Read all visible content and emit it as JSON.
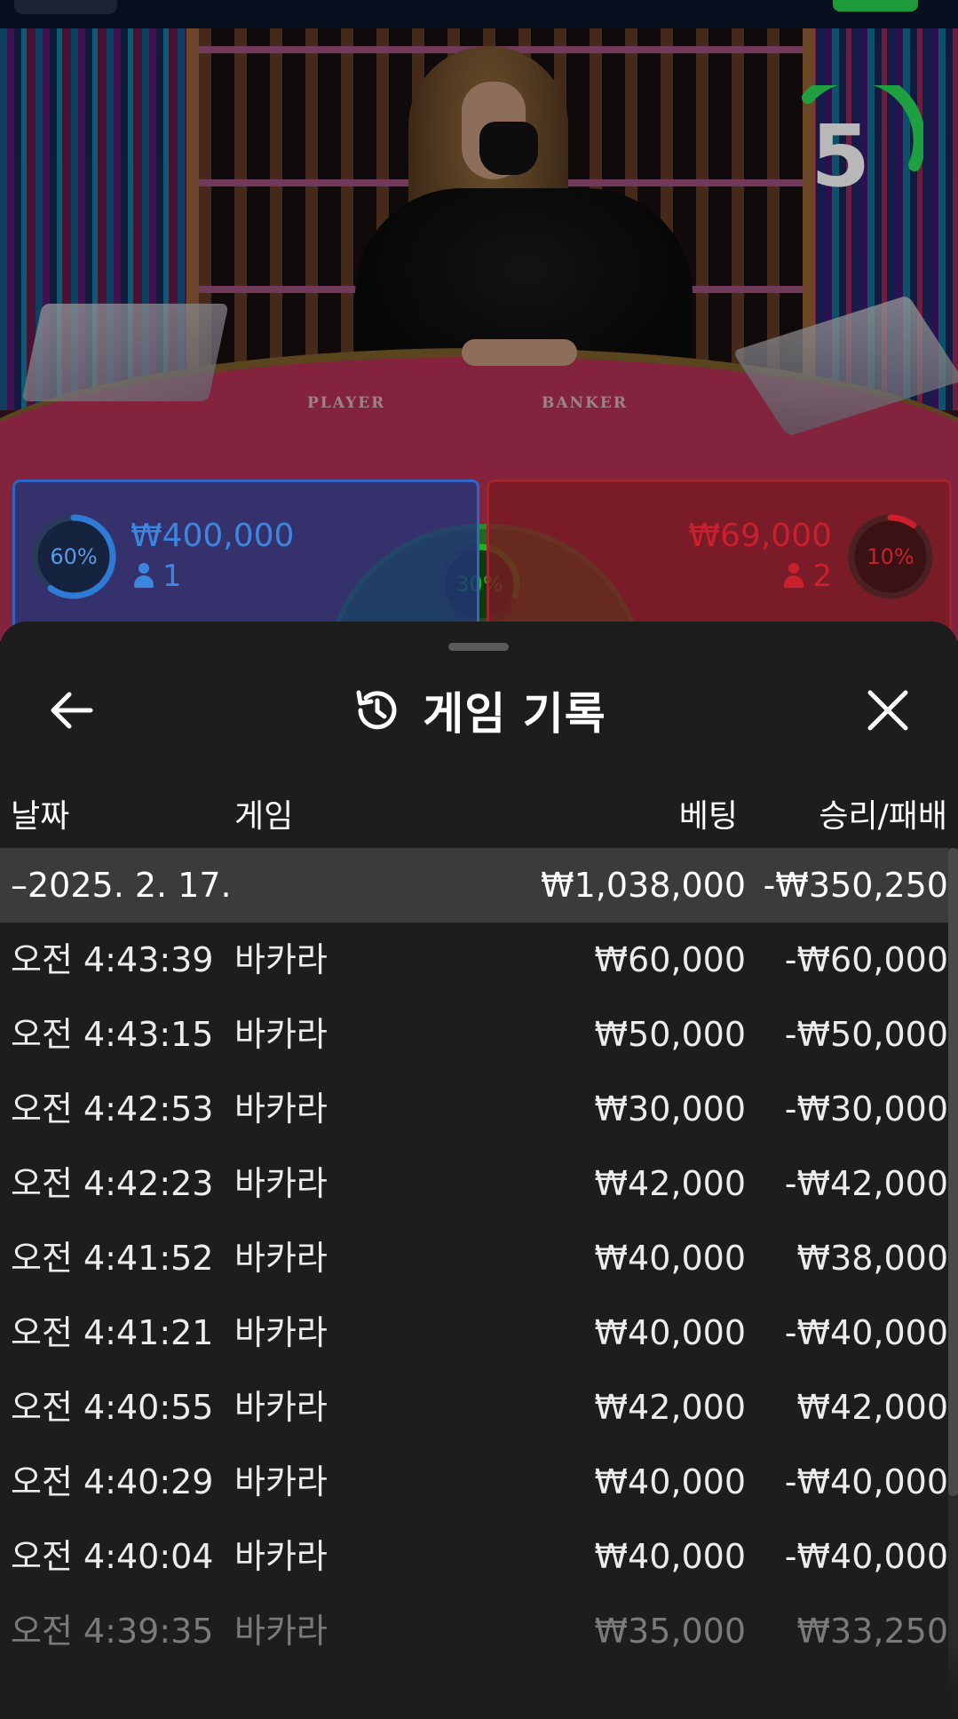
{
  "scene": {
    "countdown": "5",
    "table_labels": {
      "player": "PLAYER",
      "banker": "BANKER"
    },
    "player": {
      "percent": "60%",
      "percent_value": 0.6,
      "amount": "₩400,000",
      "count": "1",
      "color": "#2e7bd6"
    },
    "banker": {
      "percent": "10%",
      "percent_value": 0.1,
      "amount": "₩69,000",
      "count": "2",
      "color": "#c8202c"
    },
    "tie": {
      "percent": "30%",
      "percent_value": 0.3,
      "color": "#22b022"
    }
  },
  "sheet": {
    "title": "게임 기록",
    "icons": {
      "back": "arrow-left-icon",
      "history": "history-icon",
      "close": "close-icon"
    },
    "columns": {
      "date": "날짜",
      "game": "게임",
      "bet": "베팅",
      "result": "승리/패배"
    },
    "date_group": {
      "label": "–2025. 2. 17.",
      "bet_total": "₩1,038,000",
      "result_total": "-₩350,250"
    },
    "rows": [
      {
        "time": "오전 4:43:39",
        "game": "바카라",
        "bet": "₩60,000",
        "result": "-₩60,000"
      },
      {
        "time": "오전 4:43:15",
        "game": "바카라",
        "bet": "₩50,000",
        "result": "-₩50,000"
      },
      {
        "time": "오전 4:42:53",
        "game": "바카라",
        "bet": "₩30,000",
        "result": "-₩30,000"
      },
      {
        "time": "오전 4:42:23",
        "game": "바카라",
        "bet": "₩42,000",
        "result": "-₩42,000"
      },
      {
        "time": "오전 4:41:52",
        "game": "바카라",
        "bet": "₩40,000",
        "result": "₩38,000"
      },
      {
        "time": "오전 4:41:21",
        "game": "바카라",
        "bet": "₩40,000",
        "result": "-₩40,000"
      },
      {
        "time": "오전 4:40:55",
        "game": "바카라",
        "bet": "₩42,000",
        "result": "₩42,000"
      },
      {
        "time": "오전 4:40:29",
        "game": "바카라",
        "bet": "₩40,000",
        "result": "-₩40,000"
      },
      {
        "time": "오전 4:40:04",
        "game": "바카라",
        "bet": "₩40,000",
        "result": "-₩40,000"
      },
      {
        "time": "오전 4:39:35",
        "game": "바카라",
        "bet": "₩35,000",
        "result": "₩33,250"
      }
    ]
  }
}
